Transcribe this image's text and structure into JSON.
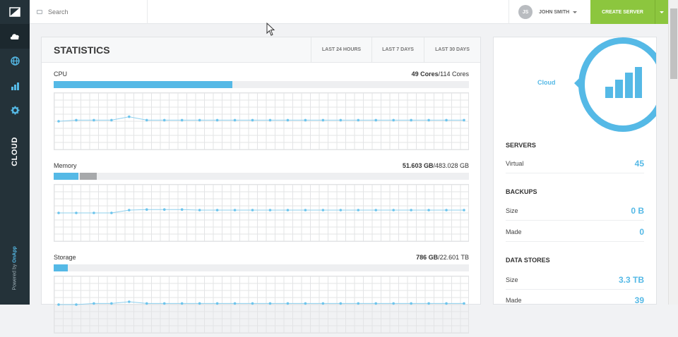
{
  "colors": {
    "accent": "#55b9e6",
    "green": "#8cc63e",
    "sidebar": "#243239",
    "grey_fill": "#a7a9ab"
  },
  "sidebar": {
    "icons": [
      "cloud-icon",
      "globe-icon",
      "bar-chart-icon",
      "gear-icon"
    ],
    "label": "CLOUD",
    "powered_prefix": "Powered by ",
    "powered_brand": "OnApp"
  },
  "topbar": {
    "search_placeholder": "Search",
    "user_initials": "JS",
    "user_name": "JOHN SMITH",
    "create_label": "CREATE SERVER"
  },
  "stats": {
    "title": "STATISTICS",
    "tabs": [
      "LAST 24 HOURS",
      "LAST 7 DAYS",
      "LAST 30 DAYS"
    ],
    "metrics": [
      {
        "name": "CPU",
        "value": "49 Cores",
        "total": "/114 Cores",
        "fill": 0.43,
        "secondary": 0,
        "series": [
          0.5,
          0.48,
          0.48,
          0.48,
          0.42,
          0.48,
          0.48,
          0.48,
          0.48,
          0.48,
          0.48,
          0.48,
          0.48,
          0.48,
          0.48,
          0.48,
          0.48,
          0.48,
          0.48,
          0.48,
          0.48,
          0.48,
          0.48,
          0.48
        ]
      },
      {
        "name": "Memory",
        "value": "51.603 GB",
        "total": "/483.028 GB",
        "fill": 0.06,
        "secondary": 0.04,
        "series": [
          0.5,
          0.5,
          0.5,
          0.5,
          0.45,
          0.44,
          0.44,
          0.44,
          0.45,
          0.45,
          0.45,
          0.45,
          0.45,
          0.45,
          0.45,
          0.45,
          0.45,
          0.45,
          0.45,
          0.45,
          0.45,
          0.45,
          0.45,
          0.45
        ]
      },
      {
        "name": "Storage",
        "value": "786 GB",
        "total": "/22.601 TB",
        "fill": 0.034,
        "secondary": 0,
        "series": [
          0.5,
          0.5,
          0.48,
          0.48,
          0.45,
          0.48,
          0.48,
          0.48,
          0.48,
          0.48,
          0.48,
          0.48,
          0.48,
          0.48,
          0.48,
          0.48,
          0.48,
          0.48,
          0.48,
          0.48,
          0.48,
          0.48,
          0.48,
          0.48
        ]
      }
    ]
  },
  "panel": {
    "cloud_label": "Cloud",
    "servers": {
      "title": "SERVERS",
      "rows": [
        {
          "key": "Virtual",
          "value": "45"
        }
      ]
    },
    "backups": {
      "title": "BACKUPS",
      "rows": [
        {
          "key": "Size",
          "value": "0 B"
        },
        {
          "key": "Made",
          "value": "0"
        }
      ]
    },
    "datastores": {
      "title": "DATA STORES",
      "rows": [
        {
          "key": "Size",
          "value": "3.3 TB"
        },
        {
          "key": "Made",
          "value": "39"
        }
      ]
    }
  }
}
